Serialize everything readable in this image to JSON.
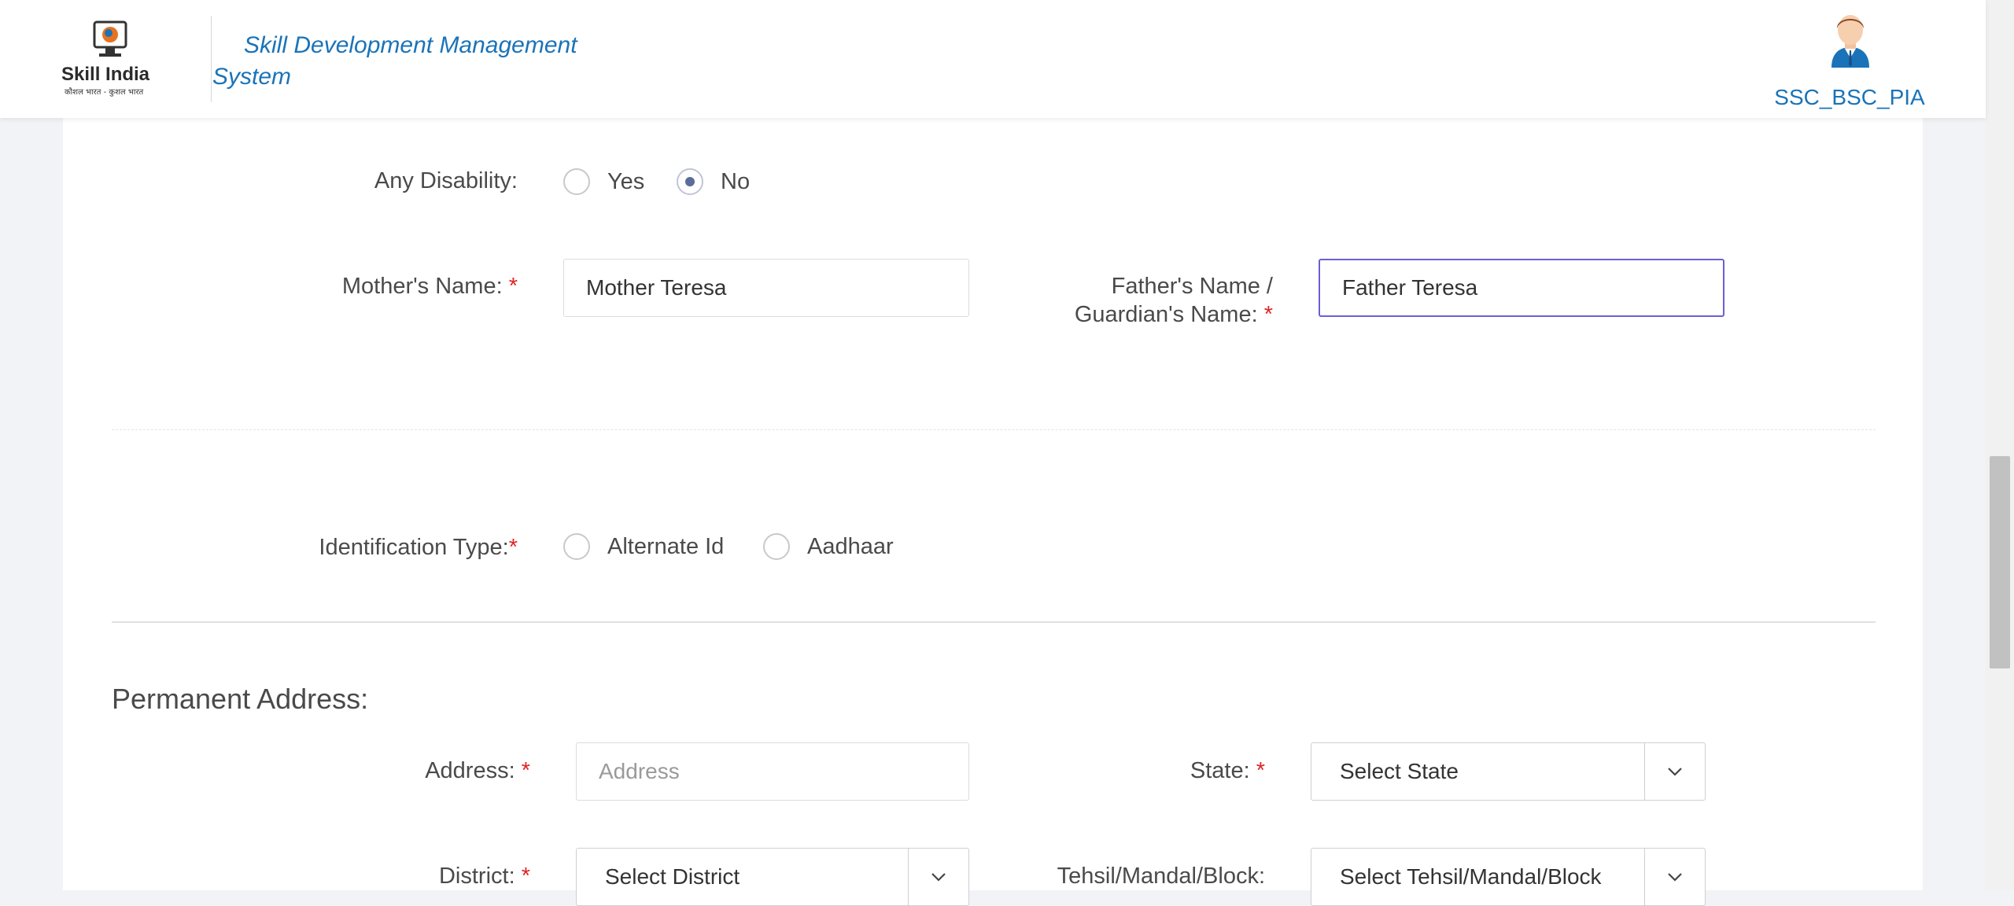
{
  "header": {
    "logo_text": "Skill India",
    "logo_subtext": "कौशल भारत - कुशल भारत",
    "app_title": "Skill Development Management System",
    "username": "SSC_BSC_PIA"
  },
  "form": {
    "disability": {
      "label": "Any Disability:",
      "options": [
        "Yes",
        "No"
      ],
      "selected": "No"
    },
    "mother_name": {
      "label": "Mother's Name:",
      "required": "*",
      "value": "Mother Teresa"
    },
    "father_name": {
      "label_line1": "Father's Name /",
      "label_line2": "Guardian's Name:",
      "required": "*",
      "value": "Father Teresa"
    },
    "identification": {
      "label": "Identification Type:",
      "required": "*",
      "options": [
        "Alternate Id",
        "Aadhaar"
      ]
    },
    "permanent_address": {
      "title": "Permanent Address:",
      "address": {
        "label": "Address:",
        "required": "*",
        "placeholder": "Address"
      },
      "state": {
        "label": "State:",
        "required": "*",
        "value": "Select State"
      },
      "district": {
        "label": "District:",
        "required": "*",
        "value": "Select District"
      },
      "tehsil": {
        "label": "Tehsil/Mandal/Block:",
        "value": "Select Tehsil/Mandal/Block"
      }
    }
  },
  "colors": {
    "brand_blue": "#1a73b8",
    "required_red": "#e02424",
    "focus_purple": "#6b5fd6"
  }
}
